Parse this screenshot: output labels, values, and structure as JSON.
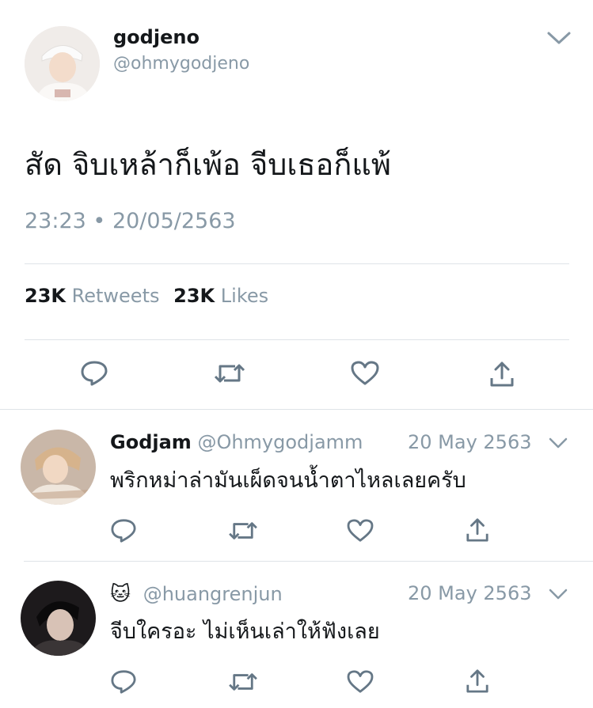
{
  "main_tweet": {
    "display_name": "godjeno",
    "handle": "@ohmygodjeno",
    "text": "สัด จิบเหล้าก็เพ้อ จีบเธอก็แพ้",
    "time": "23:23",
    "separator": "•",
    "date": "20/05/2563",
    "stats": {
      "retweets_count": "23K",
      "retweets_label": "Retweets",
      "likes_count": "23K",
      "likes_label": "Likes"
    }
  },
  "replies": [
    {
      "display_name": "Godjam",
      "handle": "@Ohmygodjamm",
      "date": "20 May 2563",
      "text": "พริกหม่าล่ามันเผ็ดจนน้ำตาไหลเลยครับ"
    },
    {
      "display_name": "🐱",
      "handle": "@huangrenjun",
      "date": "20 May 2563",
      "text": "จีบใครอะ ไม่เห็นเล่าให้ฟังเลย"
    }
  ],
  "icons": [
    "chevron-down-icon",
    "reply-icon",
    "retweet-icon",
    "like-icon",
    "share-icon"
  ],
  "colors": {
    "text": "#14171a",
    "muted": "#8899a6",
    "icon": "#657786",
    "divider": "#dfe3e8"
  }
}
